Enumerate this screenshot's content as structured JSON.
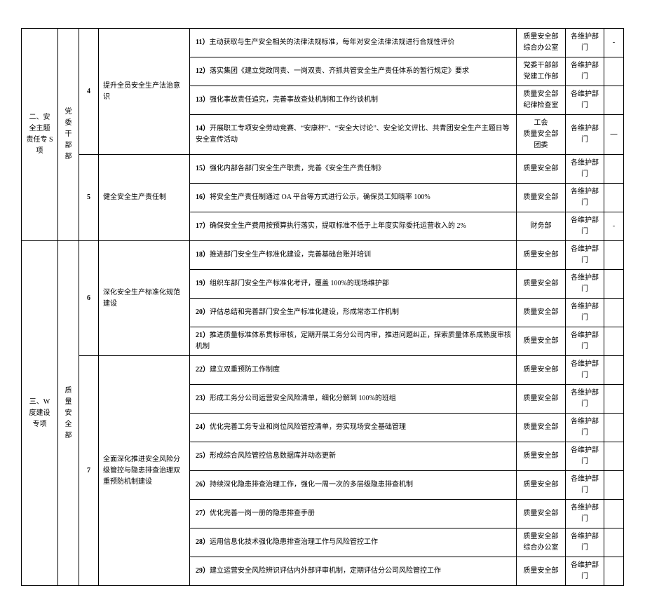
{
  "sections": {
    "s2": {
      "title": "二、安全主题责任专 S 项",
      "dept": "党委干部部"
    },
    "s3": {
      "title": "三、W 度建设专项",
      "dept": "质量安全部"
    }
  },
  "groups": {
    "g4": {
      "num": "4",
      "topic": "提升全员安全生产法治意识"
    },
    "g5": {
      "num": "5",
      "topic": "健全安全生产责任制"
    },
    "g6": {
      "num": "6",
      "topic": "深化安全生产标准化规范建设"
    },
    "g7": {
      "num": "7",
      "topic": "全面深化推进安全风险分级管控与隐患排查治理双重预防机制建设"
    }
  },
  "rows": {
    "r11": {
      "n": "11）",
      "text": "主动获取与生产安全相关的法律法规标准，每年对安全法律法规进行合规性评价",
      "resp": "质量安全部\n综合办公室",
      "coop": "各维护部门",
      "note": "-"
    },
    "r12": {
      "n": "12）",
      "text": "落实集团《建立党政同责、一岗双责、齐抓共管安全生产责任体系的暂行规定》要求",
      "resp": "党委干部部\n党建工作部",
      "coop": "各维护部门",
      "note": ""
    },
    "r13": {
      "n": "13）",
      "text": "强化事故责任追究，完善事故查处机制和工作约谈机制",
      "resp": "质量安全部\n纪律检查室",
      "coop": "各维护部门",
      "note": ""
    },
    "r14": {
      "n": "14）",
      "text": "开展职工专项安全劳动竞赛、“安康杯”、“安全大讨论”、安全论文评比、共青团安全生产主题日等安全宣传活动",
      "resp": "工会\n质量安全部团委",
      "coop": "各维护部门",
      "note": "—"
    },
    "r15": {
      "n": "15）",
      "text": "强化内部各部门安全生产职责，完善《安全生产责任制》",
      "resp": "质量安全部",
      "coop": "各维护部门",
      "note": ""
    },
    "r16": {
      "n": "16）",
      "text": "将安全生产责任制通过 OA 平台等方式进行公示，确保员工知晓率 100%",
      "resp": "质量安全部",
      "coop": "各维护部门",
      "note": ""
    },
    "r17": {
      "n": "17）",
      "text": "确保安全生产费用按预算执行落实，提取标准不低于上年度实际委托运营收入的 2%",
      "resp": "财务部",
      "coop": "各维护部门",
      "note": "-"
    },
    "r18": {
      "n": "18）",
      "text": "推进部门安全生产标准化建设，完善基础台账并培训",
      "resp": "质量安全部",
      "coop": "各维护部门",
      "note": ""
    },
    "r19": {
      "n": "19）",
      "text": "组织车部门安全生产标准化考评，覆盖 100%的现场维护部",
      "resp": "质量安全部",
      "coop": "各维护部门",
      "note": ""
    },
    "r20": {
      "n": "20）",
      "text": "评估总结和完善部门安全生产标准化建设，形成常态工作机制",
      "resp": "质量安全部",
      "coop": "各维护部门",
      "note": ""
    },
    "r21": {
      "n": "21）",
      "text": "推进质量标准体系贯标审核，定期开展工务分公司内审，推进问题纠正，探索质量体系成熟度审核机制",
      "resp": "质量安全部",
      "coop": "各维护部门",
      "note": ""
    },
    "r22": {
      "n": "22）",
      "text": "建立双重预防工作制度",
      "resp": "质量安全部",
      "coop": "各维护部门",
      "note": ""
    },
    "r23": {
      "n": "23）",
      "text": "形成工务分公司运营安全风险清单，细化分解到 100%的班组",
      "resp": "质量安全部",
      "coop": "各维护部门",
      "note": ""
    },
    "r24": {
      "n": "24）",
      "text": "优化完善工务专业和岗位风险管控清单，夯实现场安全基础管理",
      "resp": "质量安全部",
      "coop": "各维护部门",
      "note": ""
    },
    "r25": {
      "n": "25）",
      "text": "形成综合风险管控信息数据库并动态更新",
      "resp": "质量安全部",
      "coop": "各维护部门",
      "note": ""
    },
    "r26": {
      "n": "26）",
      "text": "持续深化隐患排查治理工作，强化一周一次的多层级隐患排查机制",
      "resp": "质量安全部",
      "coop": "各维护部门",
      "note": ""
    },
    "r27": {
      "n": "27）",
      "text": "优化完善一岗一册的隐患排查手册",
      "resp": "质量安全部",
      "coop": "各维护部门",
      "note": ""
    },
    "r28": {
      "n": "28）",
      "text": "运用信息化技术强化隐患排查治理工作与风险管控工作",
      "resp": "质量安全部\n综合办公室",
      "coop": "各维护部门",
      "note": ""
    },
    "r29": {
      "n": "29）",
      "text": "建立运营安全风险辨识评估内外部评审机制，定期评估分公司风险管控工作",
      "resp": "质量安全部",
      "coop": "各维护部门",
      "note": ""
    }
  }
}
